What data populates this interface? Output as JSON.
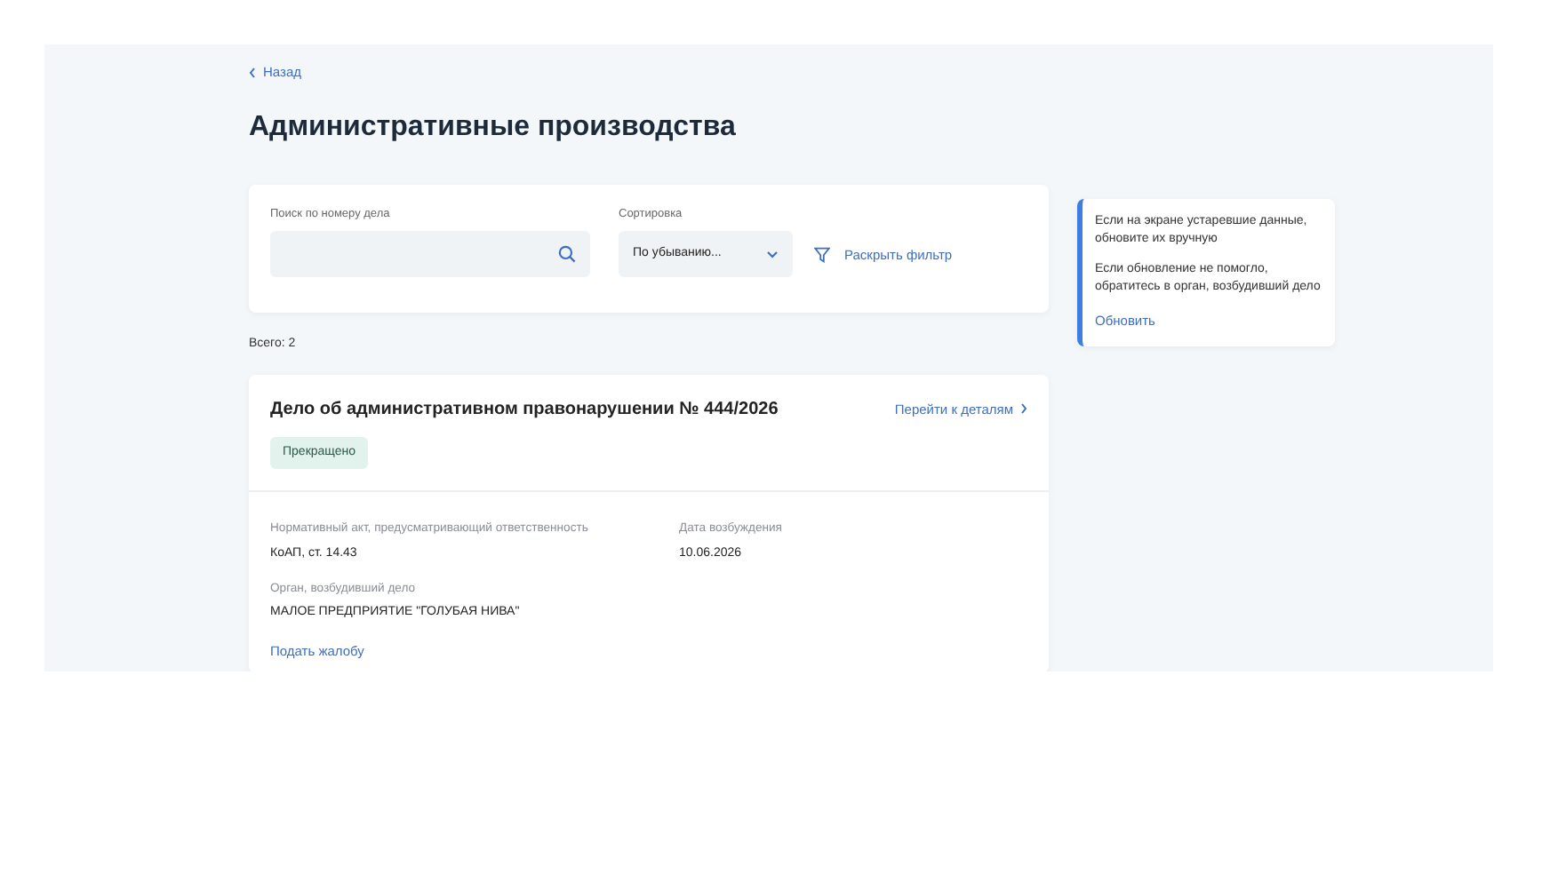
{
  "back_link": "Назад",
  "title": "Административные производства",
  "filters": {
    "search_label": "Поиск по номеру дела",
    "sort_label": "Сортировка",
    "sort_value": "По убыванию...",
    "expand_filter": "Раскрыть фильтр"
  },
  "total": "Всего: 2",
  "cases": [
    {
      "title": "Дело об административном правонарушении № 444/2026",
      "details_link": "Перейти к деталям",
      "status": "Прекращено",
      "fields": [
        {
          "label": "Нормативный акт, предусматривающий ответственность",
          "value": "КоАП, ст. 14.43"
        },
        {
          "label": "Дата возбуждения",
          "value": "10.06.2026"
        },
        {
          "label": "Орган, возбудивший дело",
          "value": "МАЛОЕ ПРЕДПРИЯТИЕ \"ГОЛУБАЯ НИВА\""
        }
      ],
      "complaint_link": "Подать жалобу"
    }
  ],
  "notice": {
    "paragraphs": [
      "Если на экране устаревшие данные, обновите их вручную",
      "Если обновление не помогло, обратитесь в орган, возбудивший дело"
    ],
    "action": "Обновить"
  }
}
